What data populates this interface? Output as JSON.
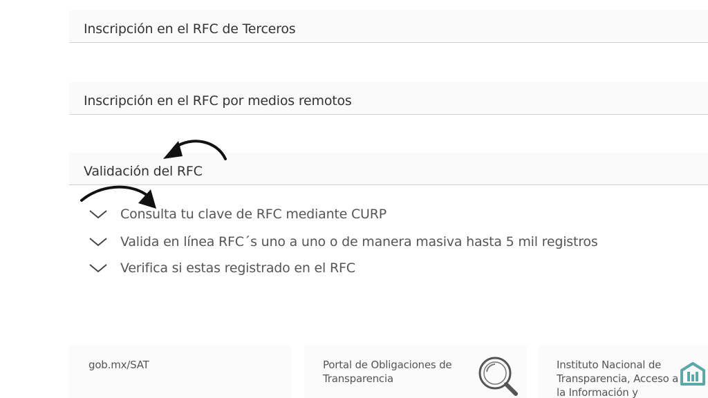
{
  "sections": [
    {
      "label": "Inscripción en el RFC de Terceros"
    },
    {
      "label": "Inscripción en el RFC por medios remotos"
    },
    {
      "label": "Validación del RFC"
    }
  ],
  "options": [
    {
      "label": "Consulta tu clave de RFC mediante CURP",
      "icon": "chevron-down-icon"
    },
    {
      "label": "Valida en línea RFC´s uno a uno o de manera masiva hasta 5 mil registros",
      "icon": "chevron-down-icon"
    },
    {
      "label": "Verifica si estas registrado en el RFC",
      "icon": "chevron-down-icon"
    }
  ],
  "annotations": [
    {
      "icon": "curved-arrow-icon",
      "target": "Validación del RFC"
    },
    {
      "icon": "curved-arrow-icon",
      "target": "Consulta tu clave de RFC mediante CURP"
    }
  ],
  "footer": {
    "links": [
      {
        "label": "gob.mx/SAT"
      },
      {
        "label": "Portal de Obligaciones de Transparencia",
        "icon": "magnifier-icon"
      },
      {
        "label": "Instituto Nacional de Transparencia, Acceso a la Información y",
        "icon": "inai-logo-icon"
      }
    ]
  },
  "colors": {
    "text": "#333333",
    "divider": "#cfcfcf",
    "header_bg": "#fafafa",
    "inai_teal": "#5aa8a8"
  }
}
